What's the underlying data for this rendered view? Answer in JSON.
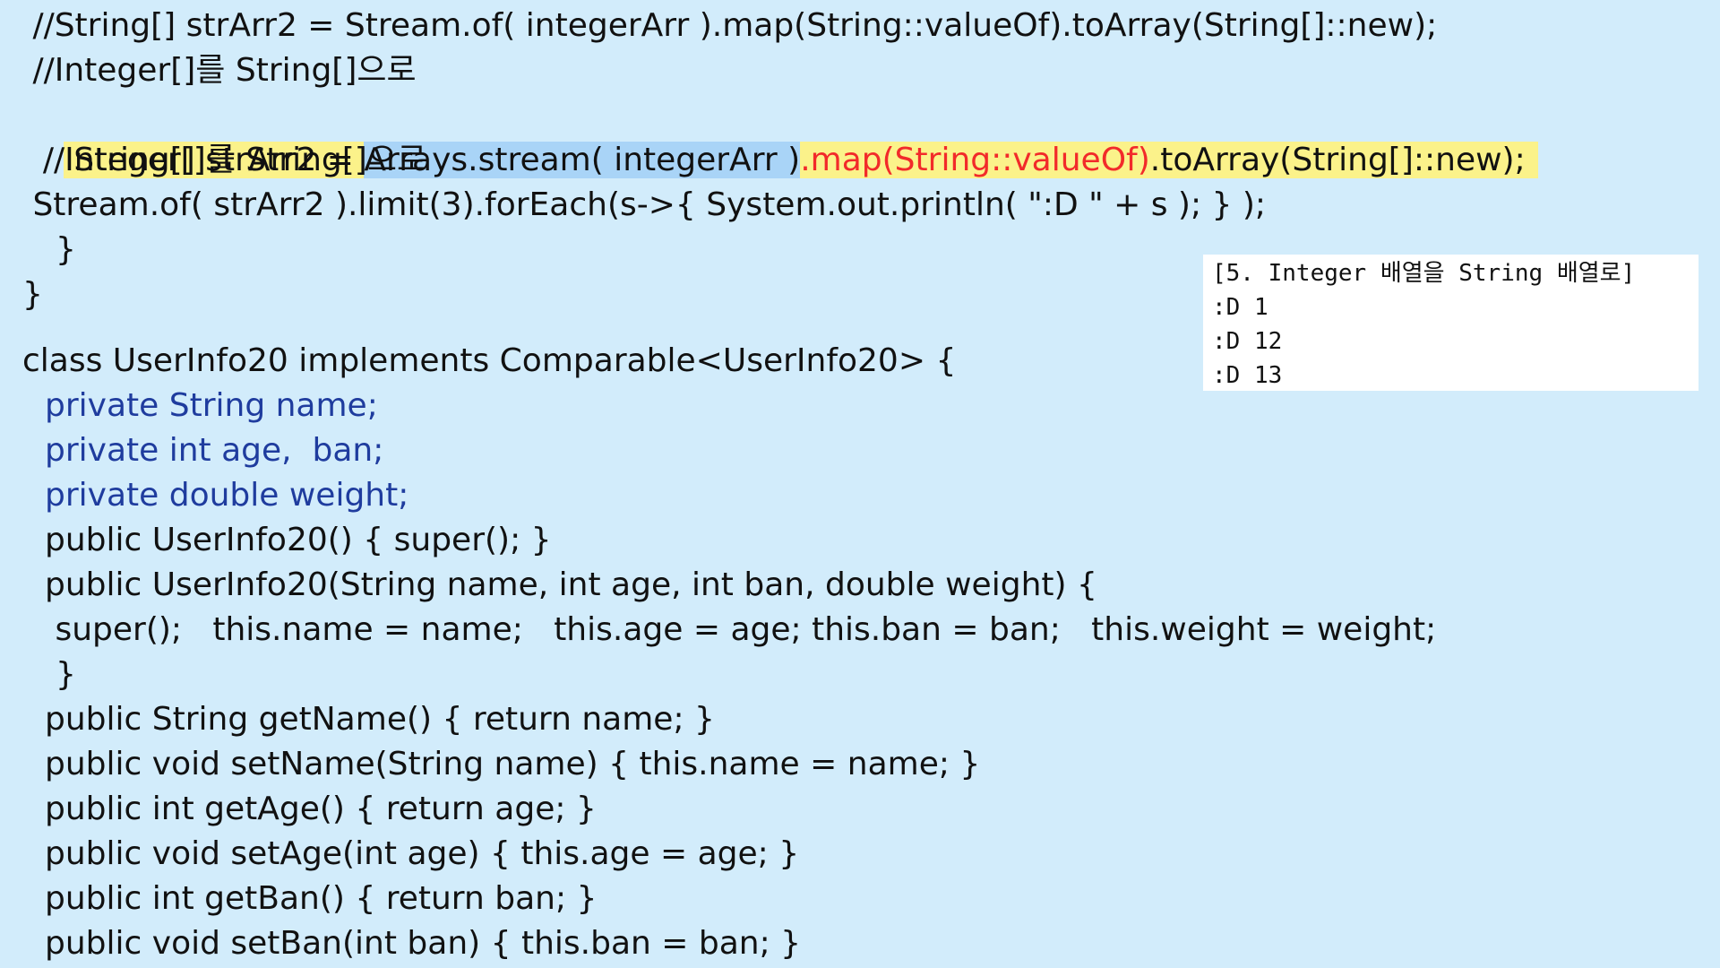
{
  "code": {
    "line_01": " //String[] strArr2 = Stream.of( integerArr ).map(String::valueOf).toArray(String[]::new);",
    "line_02": " //Integer[]를 String[]으로",
    "line_03_pre": " String[] strArr2 = ",
    "line_03_blue": "Arrays.stream( integerArr )",
    "line_03_red": ".map(String::valueOf)",
    "line_03_post": ".toArray(String[]::new);",
    "line_04": "  //Integer[]를 String[]으로",
    "line_05": " Stream.of( strArr2 ).limit(3).forEach(s->{ System.out.println( \":D \" + s ); } );",
    "line_06": "}",
    "line_07": "}",
    "line_08": "class UserInfo20 implements Comparable<UserInfo20> {",
    "line_09": "private String name;",
    "line_10": "private int age,  ban;",
    "line_11": "private double weight;",
    "line_12": "public UserInfo20() { super(); }",
    "line_13": "public UserInfo20(String name, int age, int ban, double weight) {",
    "line_14": " super();   this.name = name;   this.age = age; this.ban = ban;   this.weight = weight;",
    "line_15": "}",
    "line_16": "public String getName() { return name; }",
    "line_17": "public void setName(String name) { this.name = name; }",
    "line_18": "public int getAge() { return age; }",
    "line_19": "public void setAge(int age) { this.age = age; }",
    "line_20": "public int getBan() { return ban; }",
    "line_21": "public void setBan(int ban) { this.ban = ban; }"
  },
  "console": {
    "title": "[5. Integer 배열을 String 배열로]",
    "lines": [
      ":D 1",
      ":D 12",
      ":D 13"
    ]
  },
  "colors": {
    "background": "#d2ecfb",
    "line_highlight": "#fbf28a",
    "selection_highlight": "#a9d4f7",
    "red_text": "#f22a2a",
    "field_blue": "#1f3c9e"
  }
}
